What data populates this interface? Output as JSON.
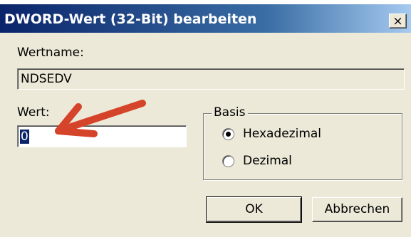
{
  "dialog": {
    "title": "DWORD-Wert (32-Bit) bearbeiten",
    "close_label": "×"
  },
  "value_name": {
    "label": "Wertname:",
    "value": "NDSEDV"
  },
  "value_data": {
    "label": "Wert:",
    "value": "0"
  },
  "base": {
    "label": "Basis",
    "options": [
      {
        "label": "Hexadezimal",
        "selected": true
      },
      {
        "label": "Dezimal",
        "selected": false
      }
    ]
  },
  "buttons": {
    "ok": "OK",
    "cancel": "Abbrechen"
  },
  "annotation": {
    "arrow_color": "#d4432a"
  },
  "colors": {
    "titlebar_start": "#0a246a",
    "titlebar_end": "#a6caf0",
    "dialog_face": "#ece9d8"
  }
}
